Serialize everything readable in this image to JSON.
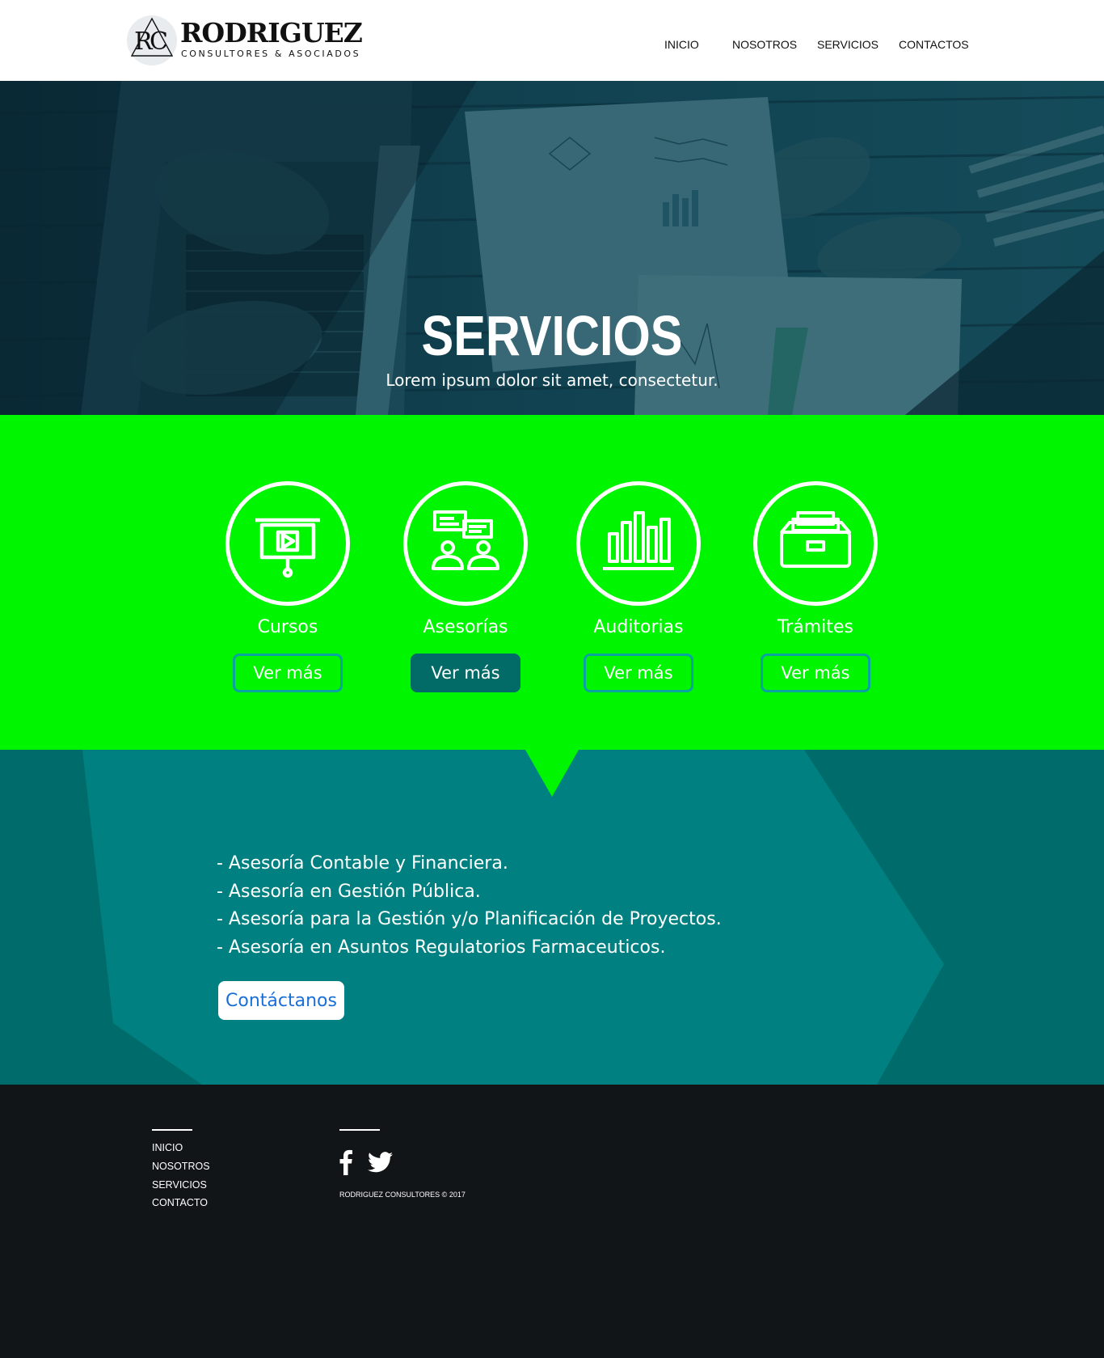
{
  "header": {
    "logo": {
      "name": "RODRIGUEZ",
      "tagline": "CONSULTORES & ASOCIADOS",
      "monogram": "RC"
    },
    "nav": [
      {
        "label": "INICIO"
      },
      {
        "label": "NOSOTROS"
      },
      {
        "label": "SERVICIOS"
      },
      {
        "label": "CONTACTOS"
      }
    ]
  },
  "hero": {
    "title": "SERVICIOS",
    "subtitle": "Lorem ipsum dolor sit amet, consectetur."
  },
  "services": [
    {
      "title": "Cursos",
      "button": "Ver más",
      "icon": "presentation-icon"
    },
    {
      "title": "Asesorías",
      "button": "Ver más",
      "icon": "consulting-icon"
    },
    {
      "title": "Auditorias",
      "button": "Ver más",
      "icon": "bar-chart-icon"
    },
    {
      "title": "Trámites",
      "button": "Ver más",
      "icon": "file-drawer-icon"
    }
  ],
  "advisory": {
    "items": [
      "- Asesoría Contable y Financiera.",
      "- Asesoría en Gestión Pública.",
      "- Asesoría para la Gestión y/o Planificación de Proyectos.",
      "- Asesoría en Asuntos Regulatorios Farmaceuticos."
    ],
    "cta": "Contáctanos"
  },
  "footer": {
    "nav": [
      {
        "label": "INICIO"
      },
      {
        "label": "NOSOTROS"
      },
      {
        "label": "SERVICIOS"
      },
      {
        "label": "CONTACTO"
      }
    ],
    "social": [
      "facebook-icon",
      "twitter-icon"
    ],
    "copyright": "RODRIGUEZ CONSULTORES © 2017"
  },
  "colors": {
    "services_bg": "#00f600",
    "teal_bg": "#006b6b",
    "teal_light": "#008080",
    "footer_bg": "#111517",
    "cta_text": "#1a6fd6"
  }
}
